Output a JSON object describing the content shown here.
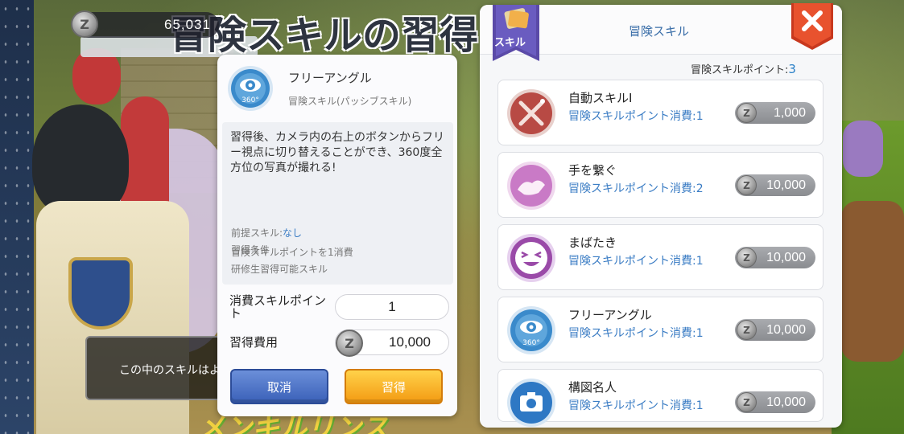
{
  "currency": {
    "amount": "65,031"
  },
  "screen_title": "冒険スキルの習得",
  "background_dialog": {
    "text": "この中のスキルはよ"
  },
  "detail": {
    "skill_name": "フリーアングル",
    "category": "冒険スキル(パッシブスキル)",
    "description": "習得後、カメラ内の右上のボタンからフリー視点に切り替えることができ、360度全方位の写真が撮れる!",
    "requirements_title": "習得条件",
    "requirement_1": "研修生習得可能スキル",
    "prereq_label": "前提スキル:",
    "prereq_value": "なし",
    "requirement_3": "冒険スキルポイントを1消費",
    "points_label": "消費スキルポイント",
    "points_value": "1",
    "cost_label": "習得費用",
    "cost_value": "10,000",
    "cancel_label": "取消",
    "learn_label": "習得"
  },
  "list": {
    "banner_label": "スキル",
    "title": "冒険スキル",
    "points_label": "冒険スキルポイント:",
    "points_value": "3",
    "skills": [
      {
        "name": "自動スキルI",
        "cost": "冒険スキルポイント消費:1",
        "price": "1,000",
        "icon": "crossed-swords-icon",
        "color": "#b84a44"
      },
      {
        "name": "手を繋ぐ",
        "cost": "冒険スキルポイント消費:2",
        "price": "10,000",
        "icon": "holding-hands-icon",
        "color": "#c97ac6"
      },
      {
        "name": "まばたき",
        "cost": "冒険スキルポイント消費:1",
        "price": "10,000",
        "icon": "winking-face-icon",
        "color": "#9a4aa8"
      },
      {
        "name": "フリーアングル",
        "cost": "冒険スキルポイント消費:1",
        "price": "10,000",
        "icon": "eye-360-icon",
        "color": "#3a8acb"
      },
      {
        "name": "構図名人",
        "cost": "冒険スキルポイント消費:1",
        "price": "10,000",
        "icon": "camera-icon",
        "color": "#2e78c4"
      }
    ]
  },
  "colors": {
    "accent_blue": "#3a7cc4",
    "cancel_button": "#3a60b8",
    "learn_button": "#f39a12",
    "close_button": "#e0482a"
  }
}
